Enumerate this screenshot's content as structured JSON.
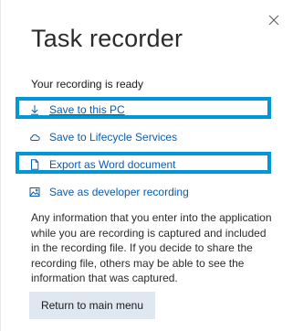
{
  "panel": {
    "title": "Task recorder",
    "status": "Your recording is ready"
  },
  "actions": [
    {
      "label": "Save to this PC",
      "icon": "download-arrow-icon"
    },
    {
      "label": "Save to Lifecycle Services",
      "icon": "cloud-icon"
    },
    {
      "label": "Export as Word document",
      "icon": "document-icon"
    },
    {
      "label": "Save as developer recording",
      "icon": "image-icon"
    }
  ],
  "info_text": "Any information that you enter into the application while you are recording is captured and included in the recording file. If you decide to share the recording file, others may be able to see the information that was captured.",
  "buttons": {
    "return": "Return to main menu",
    "close_icon": "close-icon"
  },
  "colors": {
    "link": "#0b5cad",
    "highlight": "#0097d8",
    "button_bg": "#dfe7f1",
    "text": "#2b2b2b"
  }
}
